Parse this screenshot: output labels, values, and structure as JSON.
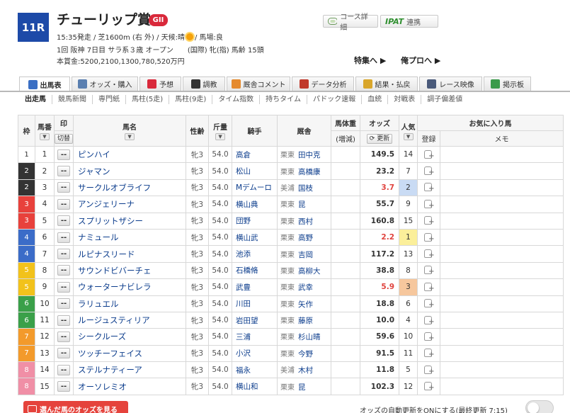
{
  "race": {
    "number": "11R",
    "name": "チューリップ賞",
    "grade": "GII",
    "data1_a": "15:35発走 / 芝1600m (右 外) / 天候:晴",
    "data1_b": "/ 馬場:良",
    "data2": "1回 阪神 7日目 サラ系３歳 オープン　　(国際) 牝(指) 馬齢 15頭",
    "prize": "本賞金:5200,2100,1300,780,520万円"
  },
  "header_buttons": {
    "course": "コース詳細",
    "ipat_logo": "IPAT",
    "ipat": "連携"
  },
  "links": {
    "tokushu": "特集へ ▶",
    "orepro": "俺プロへ ▶"
  },
  "main_tabs": [
    {
      "label": "出馬表",
      "icon": "table-icon",
      "color": "#3a6fc4"
    },
    {
      "label": "オッズ・購入",
      "icon": "odds-icon",
      "color": "#5a7fb0"
    },
    {
      "label": "予想",
      "icon": "target-icon",
      "color": "#d9293b"
    },
    {
      "label": "調教",
      "icon": "stopwatch-icon",
      "color": "#333333"
    },
    {
      "label": "厩舎コメント",
      "icon": "person-icon",
      "color": "#e58a2e"
    },
    {
      "label": "データ分析",
      "icon": "chart-icon",
      "color": "#c0392b"
    },
    {
      "label": "結果・払戻",
      "icon": "coins-icon",
      "color": "#d9a62b"
    },
    {
      "label": "レース映像",
      "icon": "video-icon",
      "color": "#4a5a7a"
    },
    {
      "label": "掲示板",
      "icon": "chat-icon",
      "color": "#3a9a4a"
    }
  ],
  "sub_tabs": [
    "出走馬",
    "競馬新聞",
    "専門紙",
    "馬柱(5走)",
    "馬柱(9走)",
    "タイム指数",
    "持ちタイム",
    "パドック速報",
    "血統",
    "対戦表",
    "調子偏差値"
  ],
  "table": {
    "headers": {
      "waku": "枠",
      "umaban": "馬番",
      "mark": "印",
      "mark_btn": "切替",
      "horse": "馬名",
      "sexage": "性齢",
      "weight": "斤量",
      "jockey": "騎手",
      "trainer": "厩舎",
      "body_weight": "馬体重",
      "body_weight_sub": "(増減)",
      "odds": "オッズ",
      "odds_btn": "更新",
      "popularity": "人気",
      "favorite": "お気に入り馬",
      "register": "登録",
      "memo": "メモ"
    },
    "mark_placeholder": "--",
    "rows": [
      {
        "waku": "1",
        "umaban": "1",
        "horse": "ピンハイ",
        "sexage": "牝3",
        "weight": "54.0",
        "jockey": "高倉",
        "region": "栗東",
        "trainer": "田中克",
        "odds": "149.5",
        "pop": "14"
      },
      {
        "waku": "2",
        "umaban": "2",
        "horse": "ジャマン",
        "sexage": "牝3",
        "weight": "54.0",
        "jockey": "松山",
        "region": "栗東",
        "trainer": "高橋康",
        "odds": "23.2",
        "pop": "7"
      },
      {
        "waku": "2",
        "umaban": "3",
        "horse": "サークルオブライフ",
        "sexage": "牝3",
        "weight": "54.0",
        "jockey": "Mデムーロ",
        "region": "美浦",
        "trainer": "国枝",
        "odds": "3.7",
        "pop": "2"
      },
      {
        "waku": "3",
        "umaban": "4",
        "horse": "アンジェリーナ",
        "sexage": "牝3",
        "weight": "54.0",
        "jockey": "横山典",
        "region": "栗東",
        "trainer": "昆",
        "odds": "55.7",
        "pop": "9"
      },
      {
        "waku": "3",
        "umaban": "5",
        "horse": "スプリットザシー",
        "sexage": "牝3",
        "weight": "54.0",
        "jockey": "団野",
        "region": "栗東",
        "trainer": "西村",
        "odds": "160.8",
        "pop": "15"
      },
      {
        "waku": "4",
        "umaban": "6",
        "horse": "ナミュール",
        "sexage": "牝3",
        "weight": "54.0",
        "jockey": "横山武",
        "region": "栗東",
        "trainer": "高野",
        "odds": "2.2",
        "pop": "1"
      },
      {
        "waku": "4",
        "umaban": "7",
        "horse": "ルピナスリード",
        "sexage": "牝3",
        "weight": "54.0",
        "jockey": "池添",
        "region": "栗東",
        "trainer": "吉岡",
        "odds": "117.2",
        "pop": "13"
      },
      {
        "waku": "5",
        "umaban": "8",
        "horse": "サウンドビバーチェ",
        "sexage": "牝3",
        "weight": "54.0",
        "jockey": "石橋脩",
        "region": "栗東",
        "trainer": "高柳大",
        "odds": "38.8",
        "pop": "8"
      },
      {
        "waku": "5",
        "umaban": "9",
        "horse": "ウォーターナビレラ",
        "sexage": "牝3",
        "weight": "54.0",
        "jockey": "武豊",
        "region": "栗東",
        "trainer": "武幸",
        "odds": "5.9",
        "pop": "3"
      },
      {
        "waku": "6",
        "umaban": "10",
        "horse": "ラリュエル",
        "sexage": "牝3",
        "weight": "54.0",
        "jockey": "川田",
        "region": "栗東",
        "trainer": "矢作",
        "odds": "18.8",
        "pop": "6"
      },
      {
        "waku": "6",
        "umaban": "11",
        "horse": "ルージュスティリア",
        "sexage": "牝3",
        "weight": "54.0",
        "jockey": "岩田望",
        "region": "栗東",
        "trainer": "藤原",
        "odds": "10.0",
        "pop": "4"
      },
      {
        "waku": "7",
        "umaban": "12",
        "horse": "シークルーズ",
        "sexage": "牝3",
        "weight": "54.0",
        "jockey": "三浦",
        "region": "栗東",
        "trainer": "杉山晴",
        "odds": "59.6",
        "pop": "10"
      },
      {
        "waku": "7",
        "umaban": "13",
        "horse": "ツッチーフェイス",
        "sexage": "牝3",
        "weight": "54.0",
        "jockey": "小沢",
        "region": "栗東",
        "trainer": "今野",
        "odds": "91.5",
        "pop": "11"
      },
      {
        "waku": "8",
        "umaban": "14",
        "horse": "ステルナティーア",
        "sexage": "牝3",
        "weight": "54.0",
        "jockey": "福永",
        "region": "美浦",
        "trainer": "木村",
        "odds": "11.8",
        "pop": "5"
      },
      {
        "waku": "8",
        "umaban": "15",
        "horse": "オーソレミオ",
        "sexage": "牝3",
        "weight": "54.0",
        "jockey": "横山和",
        "region": "栗東",
        "trainer": "昆",
        "odds": "102.3",
        "pop": "12"
      }
    ]
  },
  "waku_colors": {
    "1": {
      "bg": "#ffffff",
      "fg": "#333333"
    },
    "2": {
      "bg": "#333333",
      "fg": "#ffffff"
    },
    "3": {
      "bg": "#e8413c",
      "fg": "#ffffff"
    },
    "4": {
      "bg": "#3b6cc8",
      "fg": "#ffffff"
    },
    "5": {
      "bg": "#f2c21b",
      "fg": "#ffffff"
    },
    "6": {
      "bg": "#3aa049",
      "fg": "#ffffff"
    },
    "7": {
      "bg": "#f39a2b",
      "fg": "#ffffff"
    },
    "8": {
      "bg": "#f08fa6",
      "fg": "#ffffff"
    }
  },
  "popularity_colors": {
    "1": "#fbef9a",
    "2": "#c9dbf4",
    "3": "#f6c79d"
  },
  "hot_odds_color": "#e0433e",
  "footer": {
    "fav_odds_button": "選んだ馬のオッズを見る",
    "auto_update": "オッズの自動更新をONにする(最終更新 7:15)"
  }
}
